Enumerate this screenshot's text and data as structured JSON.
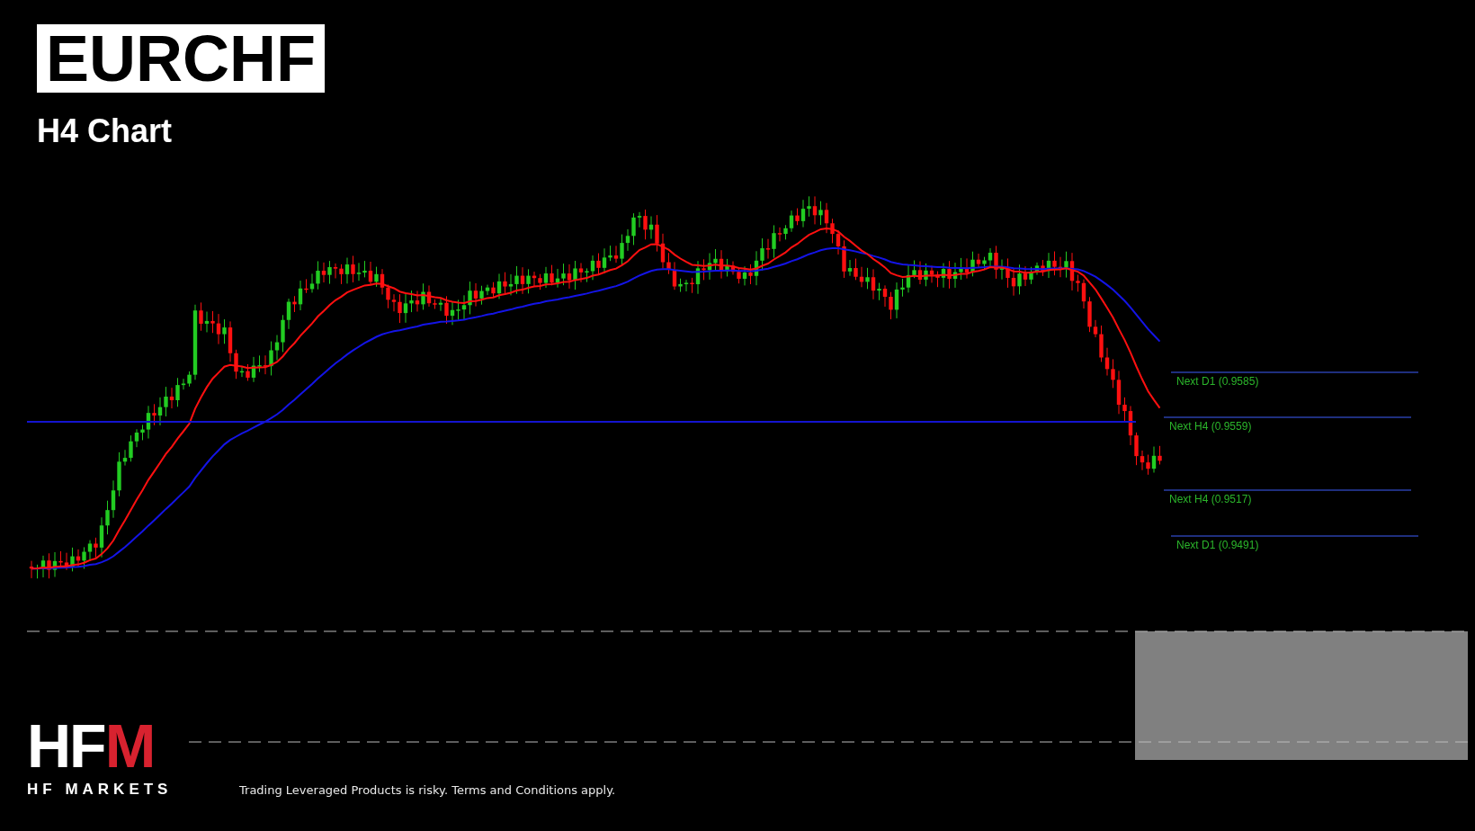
{
  "title": "EURCHF",
  "subtitle": "H4 Chart",
  "levels": [
    {
      "label": "Next D1 (0.9585)",
      "kind": "d1"
    },
    {
      "label": "Next H4 (0.9559)",
      "kind": "h4"
    },
    {
      "label": "Next H4 (0.9517)",
      "kind": "h4"
    },
    {
      "label": "Next D1 (0.9491)",
      "kind": "d1"
    }
  ],
  "logo": {
    "mark": "HFM",
    "name": "HF MARKETS"
  },
  "disclaimer": "Trading Leveraged Products is risky. Terms and Conditions apply."
}
